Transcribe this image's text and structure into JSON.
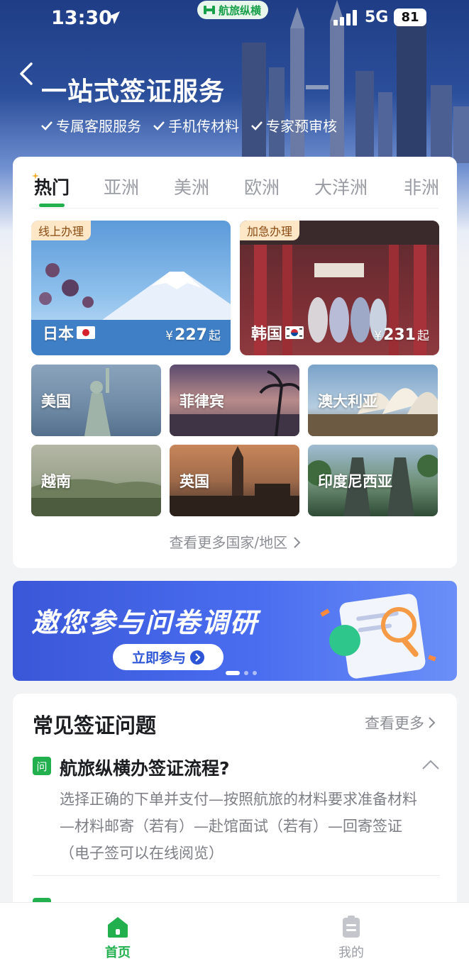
{
  "status_bar": {
    "time": "13:30",
    "network": "5G",
    "battery": "81",
    "brand": "航旅纵横"
  },
  "hero": {
    "title": "一站式签证服务",
    "features": [
      "专属客服服务",
      "手机传材料",
      "专家预审核"
    ]
  },
  "tabs": [
    "热门",
    "亚洲",
    "美洲",
    "欧洲",
    "大洋洲",
    "非洲"
  ],
  "featured": [
    {
      "badge": "线上办理",
      "country": "日本",
      "currency": "¥",
      "price": "227",
      "suffix": "起"
    },
    {
      "badge": "加急办理",
      "country": "韩国",
      "currency": "¥",
      "price": "231",
      "suffix": "起"
    }
  ],
  "destinations": [
    "美国",
    "菲律宾",
    "澳大利亚",
    "越南",
    "英国",
    "印度尼西亚"
  ],
  "more_countries": "查看更多国家/地区",
  "banner": {
    "title": "邀您参与问卷调研",
    "button": "立即参与"
  },
  "faq": {
    "title": "常见签证问题",
    "more": "查看更多",
    "badge": "问",
    "question": "航旅纵横办签证流程?",
    "answer": "选择正确的下单并支付—按照航旅的材料要求准备材料—材料邮寄（若有）—赴馆面试（若有）—回寄签证（电子签可以在线阅览）"
  },
  "nav": {
    "home": "首页",
    "mine": "我的"
  },
  "colors": {
    "accent": "#22b04f",
    "hero": "#1f3d86",
    "banner": "#3a57d8"
  }
}
